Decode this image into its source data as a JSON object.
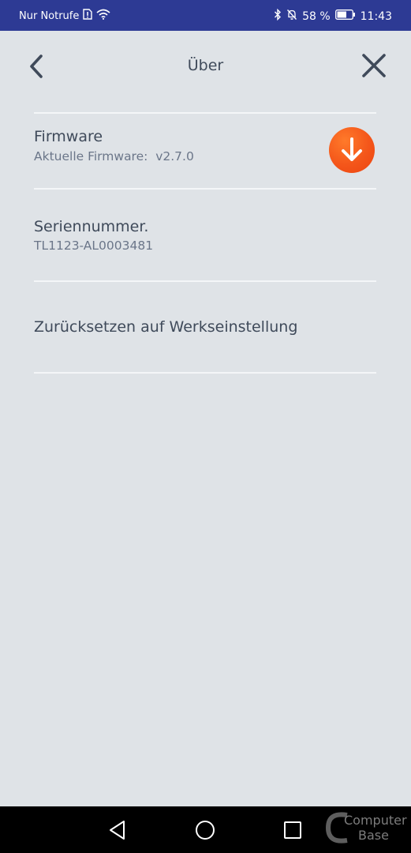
{
  "status_bar": {
    "carrier": "Nur Notrufe",
    "battery_percent": "58 %",
    "time": "11:43",
    "background_color": "#2d3a94"
  },
  "header": {
    "title": "Über",
    "back_icon": "chevron-left-icon",
    "close_icon": "close-icon"
  },
  "firmware": {
    "title": "Firmware",
    "current_label": "Aktuelle Firmware:  v2.7.0",
    "action_icon": "download-arrow-icon",
    "accent_color": "#f4561a"
  },
  "serial": {
    "title": "Seriennummer.",
    "value": "TL1123-AL0003481"
  },
  "reset": {
    "label": "Zurücksetzen auf Werkseinstellung"
  },
  "navigation": {
    "back_icon": "triangle-back-icon",
    "home_icon": "circle-home-icon",
    "recents_icon": "square-recents-icon"
  },
  "watermark": {
    "line1": "Computer",
    "line2": "Base"
  }
}
